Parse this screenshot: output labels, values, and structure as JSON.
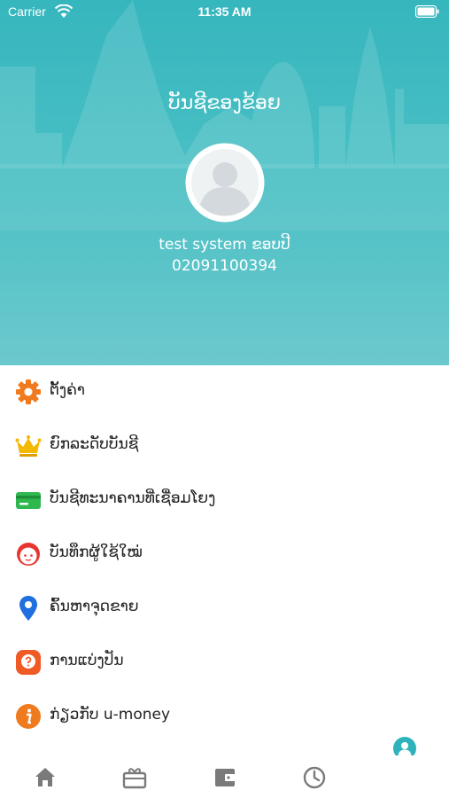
{
  "status_bar": {
    "carrier": "Carrier",
    "time": "11:35 AM"
  },
  "colors": {
    "header": "#3fbbc1",
    "settings": "#f07a1e",
    "crown": "#f5b800",
    "card": "#2eb84d",
    "face": "#e8352f",
    "pin": "#1f6fe0",
    "share": "#f05a24",
    "info": "#f07a1e",
    "fab": "#2db3b9",
    "tab_icon": "#777777"
  },
  "header": {
    "title": "ບັນຊີຂອງຂ້ອຍ",
    "user_name": "test system ຂອບປີ",
    "user_phone": "02091100394"
  },
  "menu": [
    {
      "label": "ຕັ້ງຄ່າ",
      "icon": "gear-icon"
    },
    {
      "label": "ຍົກລະດັບບັນຊີ",
      "icon": "crown-icon"
    },
    {
      "label": "ບັນຊີທະນາຄານທີ່ເຊື່ອມໂຍງ",
      "icon": "card-icon"
    },
    {
      "label": "ບັນທຶກຜູ້ໃຊ້ໃໝ່",
      "icon": "face-icon"
    },
    {
      "label": "ຄົ້ນຫາຈຸດຂາຍ",
      "icon": "location-pin-icon"
    },
    {
      "label": "ການແບ່ງປັນ",
      "icon": "question-icon"
    },
    {
      "label": "ກ່ຽວກັບ u-money",
      "icon": "info-icon"
    }
  ],
  "tabbar": [
    "home-icon",
    "gift-card-icon",
    "wallet-icon",
    "clock-icon"
  ]
}
